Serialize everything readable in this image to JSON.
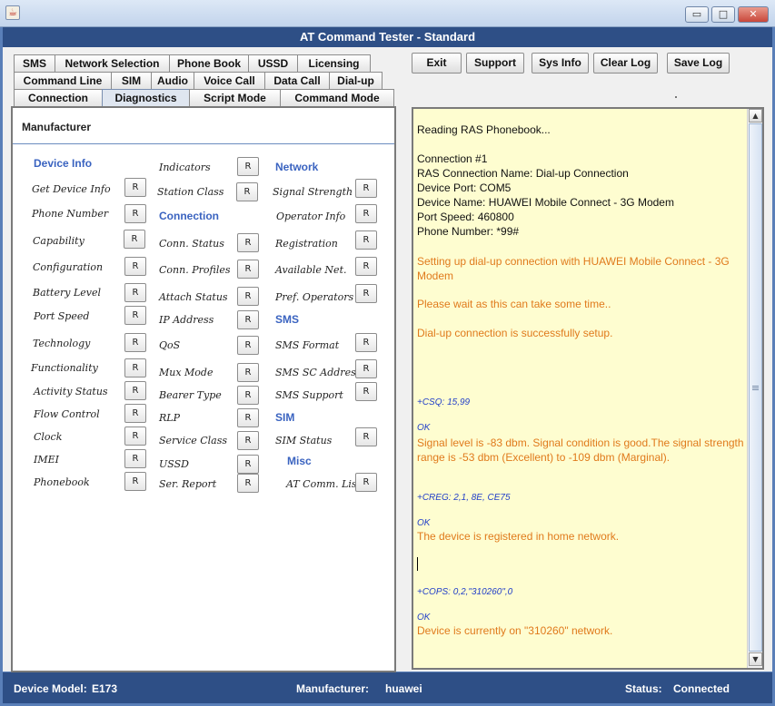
{
  "window": {
    "title": "AT Command Tester - Standard",
    "controls": {
      "minimize": "▭",
      "maximize": "□",
      "close": "✕"
    }
  },
  "tabs": {
    "row1": [
      "SMS",
      "Network Selection",
      "Phone Book",
      "USSD",
      "Licensing"
    ],
    "row2": [
      "Command Line",
      "SIM",
      "Audio",
      "Voice Call",
      "Data Call",
      "Dial-up"
    ],
    "row3": [
      "Connection",
      "Diagnostics",
      "Script Mode",
      "Command Mode"
    ],
    "active": "Diagnostics"
  },
  "toolbar": {
    "exit": "Exit",
    "support": "Support",
    "sysinfo": "Sys Info",
    "clearlog": "Clear Log",
    "savelog": "Save Log"
  },
  "diagnostics": {
    "heading": "Manufacturer",
    "button_label": "R",
    "col1": {
      "section": "Device Info",
      "items": [
        "Get Device Info",
        "Phone Number",
        "Capability",
        "Configuration",
        "Battery Level",
        "Port Speed",
        "Technology",
        "Functionality",
        "Activity Status",
        "Flow Control",
        "Clock",
        "IMEI",
        "Phonebook"
      ]
    },
    "col2": {
      "items_top": [
        "Indicators",
        "Station Class"
      ],
      "section": "Connection",
      "items": [
        "Conn. Status",
        "Conn. Profiles",
        "Attach Status",
        "IP Address",
        "QoS",
        "Mux Mode",
        "Bearer Type",
        "RLP",
        "Service Class",
        "USSD",
        "Ser. Report"
      ]
    },
    "col3": {
      "network_section": "Network",
      "network_items": [
        "Signal Strength",
        "Operator Info",
        "Registration",
        "Available Net.",
        "Pref. Operators"
      ],
      "sms_section": "SMS",
      "sms_items": [
        "SMS Format",
        "SMS SC Address",
        "SMS Support"
      ],
      "sim_section": "SIM",
      "sim_items": [
        "SIM Status"
      ],
      "misc_section": "Misc",
      "misc_items": [
        "AT Comm. List"
      ]
    }
  },
  "log": {
    "reading": "Reading RAS Phonebook...",
    "conn_num": "Connection #1",
    "ras_name": "RAS Connection Name: Dial-up Connection",
    "device_port": "Device Port: COM5",
    "device_name": "Device Name: HUAWEI Mobile Connect - 3G Modem",
    "port_speed": "Port Speed: 460800",
    "phone_number": "Phone Number: *99#",
    "setup_msg": "Setting up dial-up connection with HUAWEI Mobile Connect - 3G Modem",
    "wait_msg": "Please wait as this can take some time..",
    "success_msg": "Dial-up connection is successfully setup.",
    "csq_resp": "+CSQ: 15,99",
    "ok1": "OK",
    "signal_msg": "Signal level is -83 dbm. Signal condition is good.The signal strength range is -53 dbm (Excellent) to -109 dbm (Marginal).",
    "creg_resp": "+CREG: 2,1, 8E, CE75",
    "ok2": "OK",
    "reg_msg": "The device is registered in home network.",
    "cops_resp": "+COPS: 0,2,\"310260\",0",
    "ok3": "OK",
    "network_msg": "Device is currently on \"310260\" network."
  },
  "status": {
    "model_label": "Device Model:",
    "model_value": "E173",
    "manufacturer_label": "Manufacturer:",
    "manufacturer_value": "huawei",
    "status_label": "Status:",
    "status_value": "Connected"
  }
}
